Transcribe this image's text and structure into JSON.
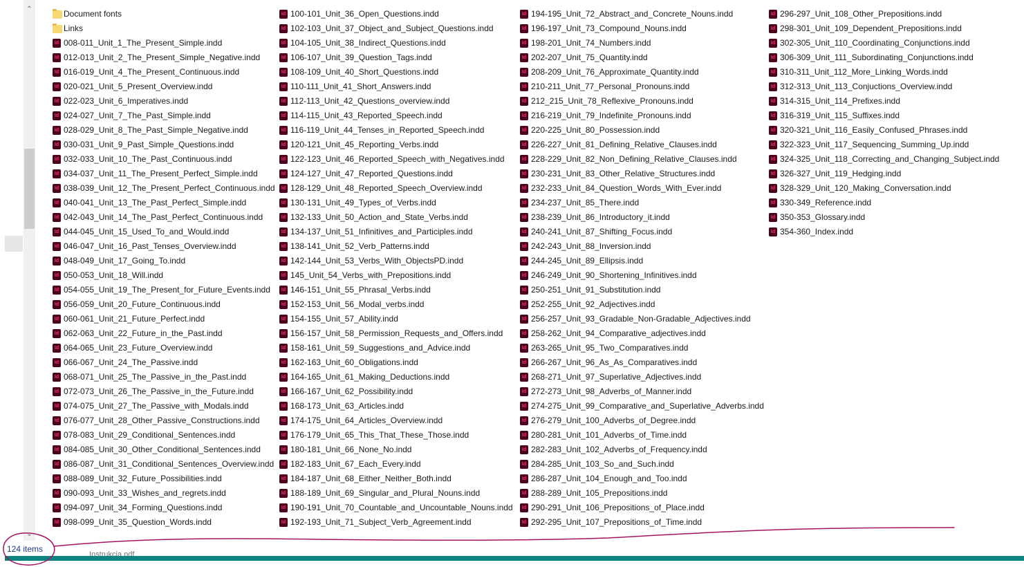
{
  "status_bar": {
    "item_count": "124 items"
  },
  "taskbar": {
    "label": "Instrukcja.pdf",
    "color": "#0c8383"
  },
  "annotation": {
    "color": "#a3145f"
  },
  "icons": {
    "folder": "folder-icon",
    "indd": "indesign-file-icon"
  },
  "columns": [
    [
      {
        "name": "Document fonts",
        "type": "folder"
      },
      {
        "name": "Links",
        "type": "folder"
      },
      {
        "name": "008-011_Unit_1_The_Present_Simple.indd",
        "type": "indd"
      },
      {
        "name": "012-013_Unit_2_The_Present_Simple_Negative.indd",
        "type": "indd"
      },
      {
        "name": "016-019_Unit_4_The_Present_Continuous.indd",
        "type": "indd"
      },
      {
        "name": "020-021_Unit_5_Present_Overview.indd",
        "type": "indd"
      },
      {
        "name": "022-023_Unit_6_Imperatives.indd",
        "type": "indd"
      },
      {
        "name": "024-027_Unit_7_The_Past_Simple.indd",
        "type": "indd"
      },
      {
        "name": "028-029_Unit_8_The_Past_Simple_Negative.indd",
        "type": "indd"
      },
      {
        "name": "030-031_Unit_9_Past_Simple_Questions.indd",
        "type": "indd"
      },
      {
        "name": "032-033_Unit_10_The_Past_Continuous.indd",
        "type": "indd"
      },
      {
        "name": "034-037_Unit_11_The_Present_Perfect_Simple.indd",
        "type": "indd"
      },
      {
        "name": "038-039_Unit_12_The_Present_Perfect_Continuous.indd",
        "type": "indd"
      },
      {
        "name": "040-041_Unit_13_The_Past_Perfect_Simple.indd",
        "type": "indd"
      },
      {
        "name": "042-043_Unit_14_The_Past_Perfect_Continuous.indd",
        "type": "indd"
      },
      {
        "name": "044-045_Unit_15_Used_To_and_Would.indd",
        "type": "indd"
      },
      {
        "name": "046-047_Unit_16_Past_Tenses_Overview.indd",
        "type": "indd"
      },
      {
        "name": "048-049_Unit_17_Going_To.indd",
        "type": "indd"
      },
      {
        "name": "050-053_Unit_18_Will.indd",
        "type": "indd"
      },
      {
        "name": "054-055_Unit_19_The_Present_for_Future_Events.indd",
        "type": "indd"
      },
      {
        "name": "056-059_Unit_20_Future_Continuous.indd",
        "type": "indd"
      },
      {
        "name": "060-061_Unit_21_Future_Perfect.indd",
        "type": "indd"
      },
      {
        "name": "062-063_Unit_22_Future_in_the_Past.indd",
        "type": "indd"
      },
      {
        "name": "064-065_Unit_23_Future_Overview.indd",
        "type": "indd"
      },
      {
        "name": "066-067_Unit_24_The_Passive.indd",
        "type": "indd"
      },
      {
        "name": "068-071_Unit_25_The_Passive_in_the_Past.indd",
        "type": "indd"
      },
      {
        "name": "072-073_Unit_26_The_Passive_in_the_Future.indd",
        "type": "indd"
      },
      {
        "name": "074-075_Unit_27_The_Passive_with_Modals.indd",
        "type": "indd"
      },
      {
        "name": "076-077_Unit_28_Other_Passive_Constructions.indd",
        "type": "indd"
      },
      {
        "name": "078-083_Unit_29_Conditional_Sentences.indd",
        "type": "indd"
      },
      {
        "name": "084-085_Unit_30_Other_Conditional_Sentences.indd",
        "type": "indd"
      },
      {
        "name": "086-087_Unit_31_Conditional_Sentences_Overview.indd",
        "type": "indd"
      },
      {
        "name": "088-089_Unit_32_Future_Possibilities.indd",
        "type": "indd"
      },
      {
        "name": "090-093_Unit_33_Wishes_and_regrets.indd",
        "type": "indd"
      },
      {
        "name": "094-097_Unit_34_Forming_Questions.indd",
        "type": "indd"
      },
      {
        "name": "098-099_Unit_35_Question_Words.indd",
        "type": "indd"
      }
    ],
    [
      {
        "name": "100-101_Unit_36_Open_Questions.indd",
        "type": "indd"
      },
      {
        "name": "102-103_Unit_37_Object_and_Subject_Questions.indd",
        "type": "indd"
      },
      {
        "name": "104-105_Unit_38_Indirect_Questions.indd",
        "type": "indd"
      },
      {
        "name": "106-107_Unit_39_Question_Tags.indd",
        "type": "indd"
      },
      {
        "name": "108-109_Unit_40_Short_Questions.indd",
        "type": "indd"
      },
      {
        "name": "110-111_Unit_41_Short_Answers.indd",
        "type": "indd"
      },
      {
        "name": "112-113_Unit_42_Questions_overview.indd",
        "type": "indd"
      },
      {
        "name": "114-115_Unit_43_Reported_Speech.indd",
        "type": "indd"
      },
      {
        "name": "116-119_Unit_44_Tenses_in_Reported_Speech.indd",
        "type": "indd"
      },
      {
        "name": "120-121_Unit_45_Reporting_Verbs.indd",
        "type": "indd"
      },
      {
        "name": "122-123_Unit_46_Reported_Speech_with_Negatives.indd",
        "type": "indd"
      },
      {
        "name": "124-127_Unit_47_Reported_Questions.indd",
        "type": "indd"
      },
      {
        "name": "128-129_Unit_48_Reported_Speech_Overview.indd",
        "type": "indd"
      },
      {
        "name": "130-131_Unit_49_Types_of_Verbs.indd",
        "type": "indd"
      },
      {
        "name": "132-133_Unit_50_Action_and_State_Verbs.indd",
        "type": "indd"
      },
      {
        "name": "134-137_Unit_51_Infinitives_and_Participles.indd",
        "type": "indd"
      },
      {
        "name": "138-141_Unit_52_Verb_Patterns.indd",
        "type": "indd"
      },
      {
        "name": "142-144_Unit_53_Verbs_With_ObjectsPD.indd",
        "type": "indd"
      },
      {
        "name": "145_Unit_54_Verbs_with_Prepositions.indd",
        "type": "indd"
      },
      {
        "name": "146-151_Unit_55_Phrasal_Verbs.indd",
        "type": "indd"
      },
      {
        "name": "152-153_Unit_56_Modal_verbs.indd",
        "type": "indd"
      },
      {
        "name": "154-155_Unit_57_Ability.indd",
        "type": "indd"
      },
      {
        "name": "156-157_Unit_58_Permission_Requests_and_Offers.indd",
        "type": "indd"
      },
      {
        "name": "158-161_Unit_59_Suggestions_and_Advice.indd",
        "type": "indd"
      },
      {
        "name": "162-163_Unit_60_Obligations.indd",
        "type": "indd"
      },
      {
        "name": "164-165_Unit_61_Making_Deductions.indd",
        "type": "indd"
      },
      {
        "name": "166-167_Unit_62_Possibility.indd",
        "type": "indd"
      },
      {
        "name": "168-173_Unit_63_Articles.indd",
        "type": "indd"
      },
      {
        "name": "174-175_Unit_64_Articles_Overview.indd",
        "type": "indd"
      },
      {
        "name": "176-179_Unit_65_This_That_These_Those.indd",
        "type": "indd"
      },
      {
        "name": "180-181_Unit_66_None_No.indd",
        "type": "indd"
      },
      {
        "name": "182-183_Unit_67_Each_Every.indd",
        "type": "indd"
      },
      {
        "name": "184-187_Unit_68_Either_Neither_Both.indd",
        "type": "indd"
      },
      {
        "name": "188-189_Unit_69_Singular_and_Plural_Nouns.indd",
        "type": "indd"
      },
      {
        "name": "190-191_Unit_70_Countable_and_Uncountable_Nouns.indd",
        "type": "indd"
      },
      {
        "name": "192-193_Unit_71_Subject_Verb_Agreement.indd",
        "type": "indd"
      }
    ],
    [
      {
        "name": "194-195_Unit_72_Abstract_and_Concrete_Nouns.indd",
        "type": "indd"
      },
      {
        "name": "196-197_Unit_73_Compound_Nouns.indd",
        "type": "indd"
      },
      {
        "name": "198-201_Unit_74_Numbers.indd",
        "type": "indd"
      },
      {
        "name": "202-207_Unit_75_Quantity.indd",
        "type": "indd"
      },
      {
        "name": "208-209_Unit_76_Approximate_Quantity.indd",
        "type": "indd"
      },
      {
        "name": "210-211_Unit_77_Personal_Pronouns.indd",
        "type": "indd"
      },
      {
        "name": "212_215_Unit_78_Reflexive_Pronouns.indd",
        "type": "indd"
      },
      {
        "name": "216-219_Unit_79_Indefinite_Pronouns.indd",
        "type": "indd"
      },
      {
        "name": "220-225_Unit_80_Possession.indd",
        "type": "indd"
      },
      {
        "name": "226-227_Unit_81_Defining_Relative_Clauses.indd",
        "type": "indd"
      },
      {
        "name": "228-229_Unit_82_Non_Defining_Relative_Clauses.indd",
        "type": "indd"
      },
      {
        "name": "230-231_Unit_83_Other_Relative_Structures.indd",
        "type": "indd"
      },
      {
        "name": "232-233_Unit_84_Question_Words_With_Ever.indd",
        "type": "indd"
      },
      {
        "name": "234-237_Unit_85_There.indd",
        "type": "indd"
      },
      {
        "name": "238-239_Unit_86_Introductory_it.indd",
        "type": "indd"
      },
      {
        "name": "240-241_Unit_87_Shifting_Focus.indd",
        "type": "indd"
      },
      {
        "name": "242-243_Unit_88_Inversion.indd",
        "type": "indd"
      },
      {
        "name": "244-245_Unit_89_Ellipsis.indd",
        "type": "indd"
      },
      {
        "name": "246-249_Unit_90_Shortening_Infinitives.indd",
        "type": "indd"
      },
      {
        "name": "250-251_Unit_91_Substitution.indd",
        "type": "indd"
      },
      {
        "name": "252-255_Unit_92_Adjectives.indd",
        "type": "indd"
      },
      {
        "name": "256-257_Unit_93_Gradable_Non-Gradable_Adjectives.indd",
        "type": "indd"
      },
      {
        "name": "258-262_Unit_94_Comparative_adjectives.indd",
        "type": "indd"
      },
      {
        "name": "263-265_Unit_95_Two_Comparatives.indd",
        "type": "indd"
      },
      {
        "name": "266-267_Unit_96_As_As_Comparatives.indd",
        "type": "indd"
      },
      {
        "name": "268-271_Unit_97_Superlative_Adjectives.indd",
        "type": "indd"
      },
      {
        "name": "272-273_Unit_98_Adverbs_of_Manner.indd",
        "type": "indd"
      },
      {
        "name": "274-275_Unit_99_Comparative_and_Superlative_Adverbs.indd",
        "type": "indd"
      },
      {
        "name": "276-279_Unit_100_Adverbs_of_Degree.indd",
        "type": "indd"
      },
      {
        "name": "280-281_Unit_101_Adverbs_of_Time.indd",
        "type": "indd"
      },
      {
        "name": "282-283_Unit_102_Adverbs_of_Frequency.indd",
        "type": "indd"
      },
      {
        "name": "284-285_Unit_103_So_and_Such.indd",
        "type": "indd"
      },
      {
        "name": "286-287_Unit_104_Enough_and_Too.indd",
        "type": "indd"
      },
      {
        "name": "288-289_Unit_105_Prepositions.indd",
        "type": "indd"
      },
      {
        "name": "290-291_Unit_106_Prepositions_of_Place.indd",
        "type": "indd"
      },
      {
        "name": "292-295_Unit_107_Prepositions_of_Time.indd",
        "type": "indd"
      }
    ],
    [
      {
        "name": "296-297_Unit_108_Other_Prepositions.indd",
        "type": "indd"
      },
      {
        "name": "298-301_Unit_109_Dependent_Prepositions.indd",
        "type": "indd"
      },
      {
        "name": "302-305_Unit_110_Coordinating_Conjunctions.indd",
        "type": "indd"
      },
      {
        "name": "306-309_Unit_111_Subordinating_Conjunctions.indd",
        "type": "indd"
      },
      {
        "name": "310-311_Unit_112_More_Linking_Words.indd",
        "type": "indd"
      },
      {
        "name": "312-313_Unit_113_Conjuctions_Overview.indd",
        "type": "indd"
      },
      {
        "name": "314-315_Unit_114_Prefixes.indd",
        "type": "indd"
      },
      {
        "name": "316-319_Unit_115_Suffixes.indd",
        "type": "indd"
      },
      {
        "name": "320-321_Unit_116_Easily_Confused_Phrases.indd",
        "type": "indd"
      },
      {
        "name": "322-323_Unit_117_Sequencing_Summing_Up.indd",
        "type": "indd"
      },
      {
        "name": "324-325_Unit_118_Correcting_and_Changing_Subject.indd",
        "type": "indd"
      },
      {
        "name": "326-327_Unit_119_Hedging.indd",
        "type": "indd"
      },
      {
        "name": "328-329_Unit_120_Making_Conversation.indd",
        "type": "indd"
      },
      {
        "name": "330-349_Reference.indd",
        "type": "indd"
      },
      {
        "name": "350-353_Glossary.indd",
        "type": "indd"
      },
      {
        "name": "354-360_Index.indd",
        "type": "indd"
      }
    ]
  ]
}
